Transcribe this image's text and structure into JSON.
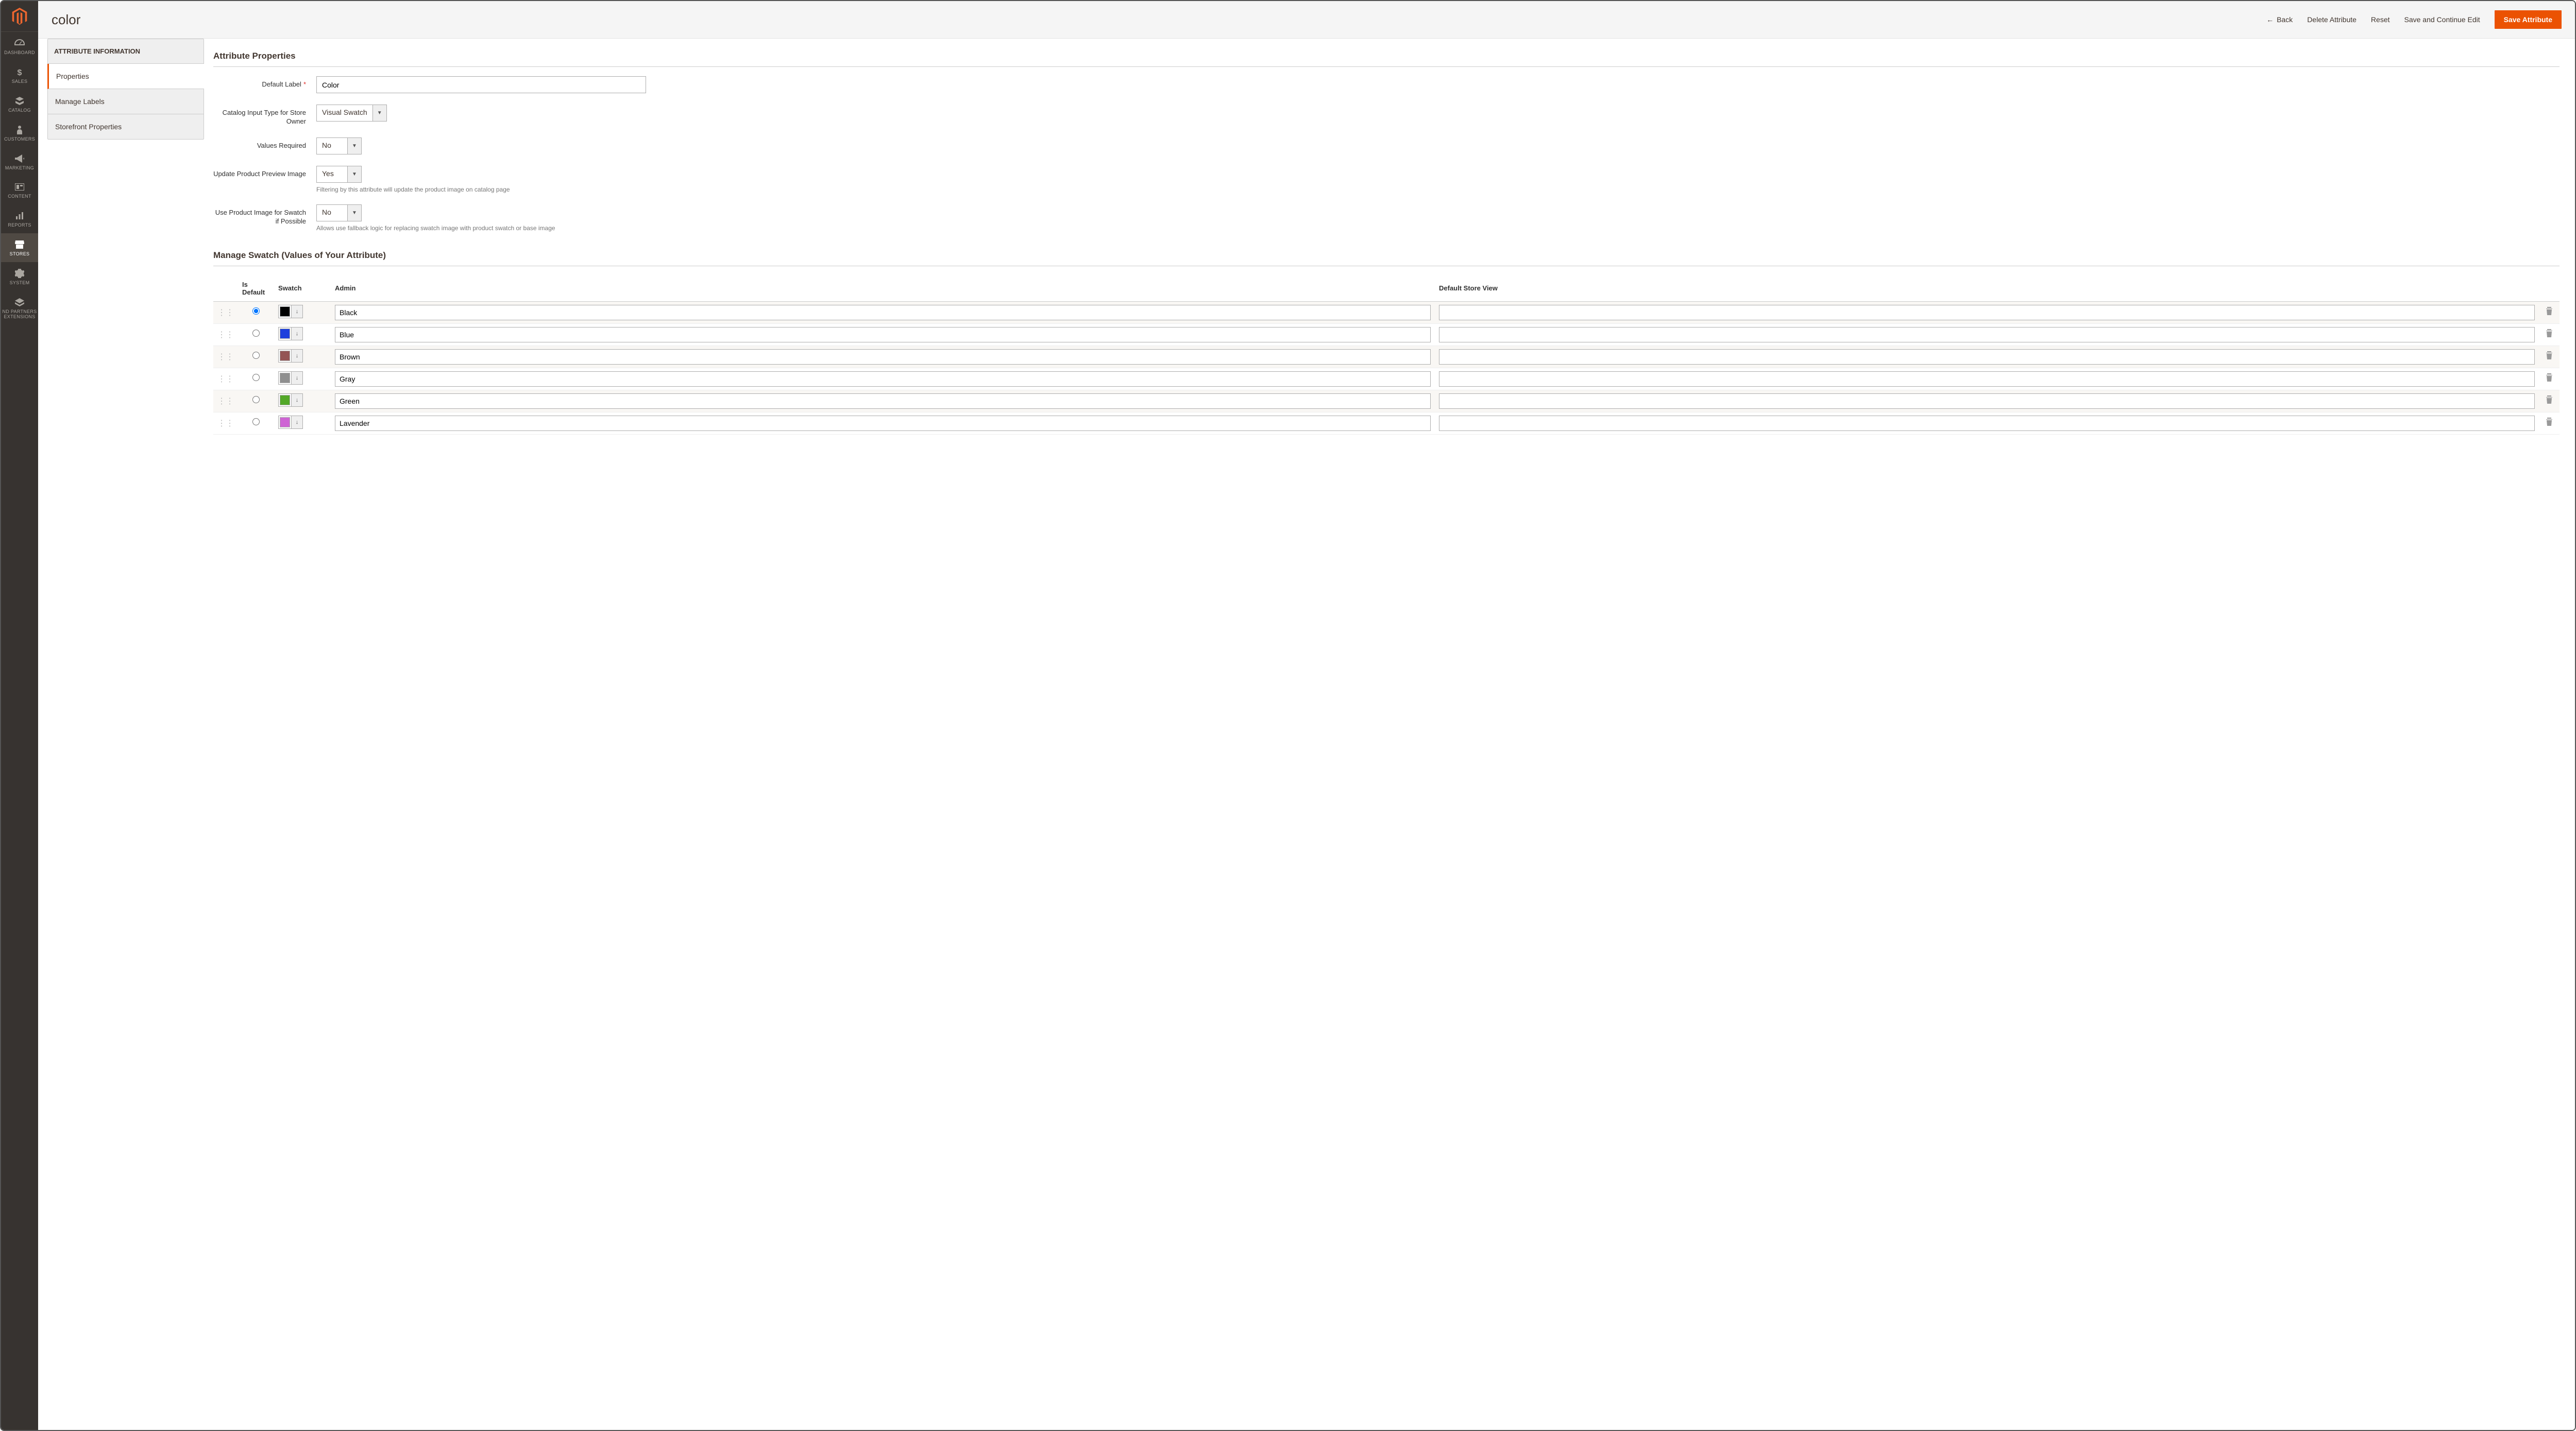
{
  "page_title": "color",
  "header": {
    "back": "Back",
    "delete": "Delete Attribute",
    "reset": "Reset",
    "save_continue": "Save and Continue Edit",
    "save": "Save Attribute"
  },
  "nav": {
    "dashboard": "DASHBOARD",
    "sales": "SALES",
    "catalog": "CATALOG",
    "customers": "CUSTOMERS",
    "marketing": "MARKETING",
    "content": "CONTENT",
    "reports": "REPORTS",
    "stores": "STORES",
    "system": "SYSTEM",
    "partners": "ND PARTNERS EXTENSIONS"
  },
  "sidebar": {
    "title": "ATTRIBUTE INFORMATION",
    "properties": "Properties",
    "manage_labels": "Manage Labels",
    "storefront": "Storefront Properties"
  },
  "sections": {
    "props_title": "Attribute Properties",
    "swatch_title": "Manage Swatch (Values of Your Attribute)"
  },
  "fields": {
    "default_label": {
      "label": "Default Label",
      "value": "Color"
    },
    "input_type": {
      "label": "Catalog Input Type for Store Owner",
      "value": "Visual Swatch"
    },
    "required": {
      "label": "Values Required",
      "value": "No"
    },
    "update_preview": {
      "label": "Update Product Preview Image",
      "value": "Yes",
      "note": "Filtering by this attribute will update the product image on catalog page"
    },
    "use_image": {
      "label": "Use Product Image for Swatch if Possible",
      "value": "No",
      "note": "Allows use fallback logic for replacing swatch image with product swatch or base image"
    }
  },
  "swatch_headers": {
    "is_default": "Is Default",
    "swatch": "Swatch",
    "admin": "Admin",
    "store_view": "Default Store View"
  },
  "swatches": [
    {
      "admin": "Black",
      "store_view": "",
      "color": "#000000",
      "default": true
    },
    {
      "admin": "Blue",
      "store_view": "",
      "color": "#1d3fdc",
      "default": false
    },
    {
      "admin": "Brown",
      "store_view": "",
      "color": "#945454",
      "default": false
    },
    {
      "admin": "Gray",
      "store_view": "",
      "color": "#8f8f8f",
      "default": false
    },
    {
      "admin": "Green",
      "store_view": "",
      "color": "#53a828",
      "default": false
    },
    {
      "admin": "Lavender",
      "store_view": "",
      "color": "#ce64d4",
      "default": false
    }
  ]
}
